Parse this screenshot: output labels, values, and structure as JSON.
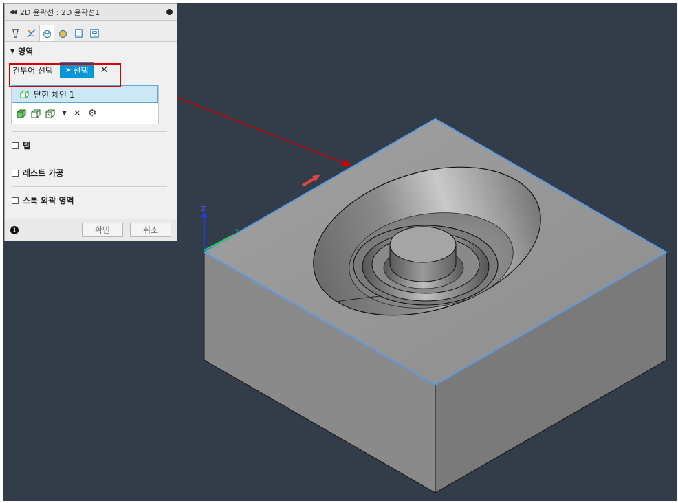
{
  "panel": {
    "title": "2D 윤곽선 : 2D 윤곽선1",
    "tabs": [
      "tool-icon",
      "geometry-icon",
      "heights-icon",
      "passes-icon",
      "linking-icon",
      "simulation-icon"
    ],
    "section_title": "영역",
    "contour_label": "컨투어 선택",
    "select_label": "선택",
    "clear_symbol": "✕",
    "chain_item_label": "닫힌 체인 1",
    "checkboxes": [
      {
        "label": "탭",
        "checked": false
      },
      {
        "label": "레스트 가공",
        "checked": false
      },
      {
        "label": "스톡 외곽 영역",
        "checked": false
      }
    ],
    "ok_label": "확인",
    "cancel_label": "취소"
  },
  "viewport": {
    "axis_z_label": "Z",
    "axis_y_label": "Y",
    "background": "#333c49",
    "highlight_color": "#5a9be6",
    "annotation_color": "#d40000"
  }
}
